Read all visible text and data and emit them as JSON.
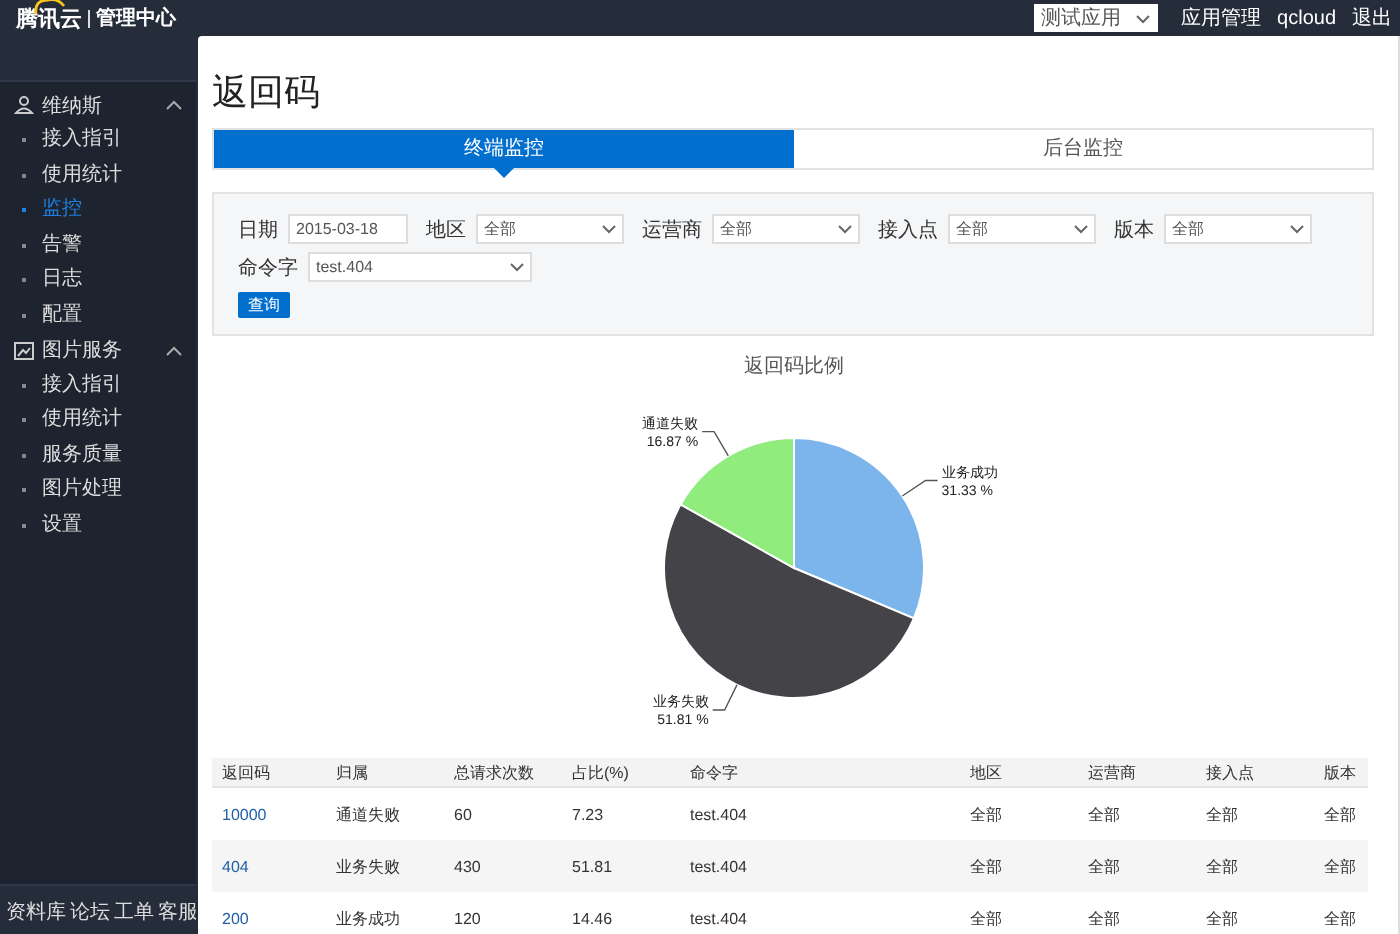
{
  "topbar": {
    "logo": "腾讯云",
    "product": "管理中心",
    "app_select": "测试应用",
    "links": [
      "应用管理",
      "qcloud",
      "退出"
    ]
  },
  "sidebar": {
    "groups": [
      {
        "label": "维纳斯",
        "expanded": true,
        "items": [
          {
            "label": "接入指引",
            "selected": false
          },
          {
            "label": "使用统计",
            "selected": false
          },
          {
            "label": "监控",
            "selected": true
          },
          {
            "label": "告警",
            "selected": false
          },
          {
            "label": "日志",
            "selected": false
          },
          {
            "label": "配置",
            "selected": false
          }
        ]
      },
      {
        "label": "图片服务",
        "expanded": true,
        "items": [
          {
            "label": "接入指引",
            "selected": false
          },
          {
            "label": "使用统计",
            "selected": false
          },
          {
            "label": "服务质量",
            "selected": false
          },
          {
            "label": "图片处理",
            "selected": false
          },
          {
            "label": "设置",
            "selected": false
          }
        ]
      }
    ],
    "footer_links": [
      "资料库",
      "论坛",
      "工单",
      "客服"
    ]
  },
  "page_title": "返回码",
  "tabs": [
    {
      "label": "终端监控",
      "selected": true
    },
    {
      "label": "后台监控",
      "selected": false
    }
  ],
  "filters": [
    {
      "label": "日期",
      "kind": "text",
      "value": "2015-03-18"
    },
    {
      "label": "地区",
      "kind": "select",
      "value": "全部"
    },
    {
      "label": "运营商",
      "kind": "select",
      "value": "全部"
    },
    {
      "label": "接入点",
      "kind": "select",
      "value": "全部"
    },
    {
      "label": "版本",
      "kind": "select",
      "value": "全部"
    },
    {
      "label": "命令字",
      "kind": "select",
      "value": "test.404"
    }
  ],
  "query_button": "查询",
  "chart_data": {
    "type": "pie",
    "title": "返回码比例",
    "categories": [
      "业务成功",
      "业务失败",
      "通道失败"
    ],
    "series": [
      {
        "colors": [
          "#7cb5ec",
          "#434348",
          "#90ed7d"
        ],
        "values": [
          31.33,
          51.81,
          16.87
        ]
      }
    ],
    "value_labels": [
      "31.33 %",
      "51.81 %",
      "16.87 %"
    ]
  },
  "table": {
    "columns": [
      "返回码",
      "归属",
      "总请求次数",
      "占比(%)",
      "命令字",
      "地区",
      "运营商",
      "接入点",
      "版本"
    ],
    "rows": [
      {
        "cells": [
          "10000",
          "通道失败",
          "60",
          "7.23",
          "test.404",
          "全部",
          "全部",
          "全部",
          "全部"
        ]
      },
      {
        "cells": [
          "404",
          "业务失败",
          "430",
          "51.81",
          "test.404",
          "全部",
          "全部",
          "全部",
          "全部"
        ]
      },
      {
        "cells": [
          "200",
          "业务成功",
          "120",
          "14.46",
          "test.404",
          "全部",
          "全部",
          "全部",
          "全部"
        ]
      }
    ]
  }
}
